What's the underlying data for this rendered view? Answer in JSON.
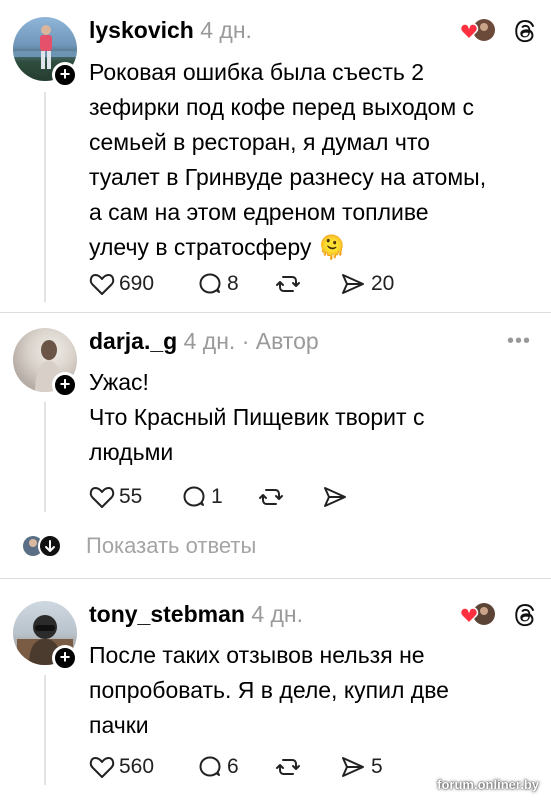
{
  "posts": [
    {
      "username": "lyskovich",
      "time": "4 дн.",
      "text_lines": [
        "Роковая ошибка была съесть 2",
        "зефирки под кофе перед выходом с",
        "семьей в ресторан, я  думал что",
        "туалет в Гринвуде разнесу на атомы,",
        "а сам на этом едреном топливе",
        "улечу в стратосферу"
      ],
      "emoji": "🫠",
      "likes": "690",
      "comments": "8",
      "shares": "20"
    },
    {
      "username": "darja._g",
      "time": "4 дн.",
      "author_badge": "· Автор",
      "more": "•••",
      "text_lines": [
        "Ужас!",
        "Что Красный Пищевик творит с",
        "людьми"
      ],
      "likes": "55",
      "comments": "1",
      "shares": ""
    },
    {
      "username": "tony_stebman",
      "time": "4 дн.",
      "text_lines": [
        "После таких отзывов нельзя не",
        "попробовать. Я в деле, купил две",
        "пачки"
      ],
      "likes": "560",
      "comments": "6",
      "shares": "5"
    }
  ],
  "show_replies": "Показать ответы",
  "watermark": "forum.onliner.by",
  "colors": {
    "heart": "#ff3040",
    "muted": "#9a9a9a",
    "divider": "#dedede"
  }
}
